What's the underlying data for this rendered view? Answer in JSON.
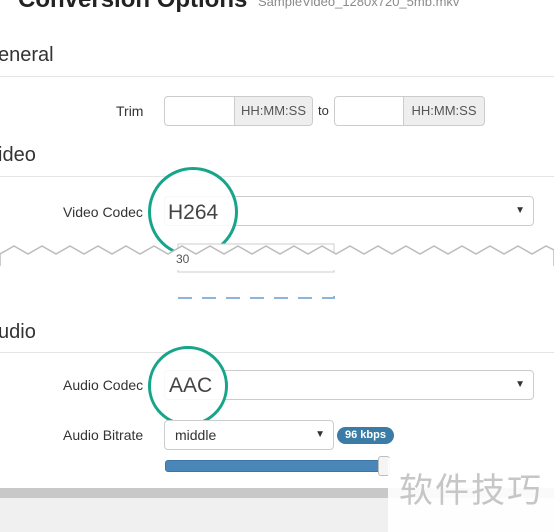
{
  "page": {
    "title": "Conversion Options",
    "subtitle": "SampleVideo_1280x720_5mb.mkv"
  },
  "general": {
    "heading": "eneral",
    "trim_label": "Trim",
    "trim_start_value": "",
    "trim_start_unit": "HH:MM:SS",
    "trim_to": "to",
    "trim_end_value": "",
    "trim_end_unit": "HH:MM:SS"
  },
  "video": {
    "heading": "ideo",
    "codec_label": "Video Codec",
    "codec_value": "H264",
    "frame_rate_partial": "30"
  },
  "audio": {
    "heading": "udio",
    "codec_label": "Audio Codec",
    "codec_value": "AAC",
    "bitrate_label": "Audio Bitrate",
    "bitrate_value": "middle",
    "bitrate_badge": "96 kbps",
    "bitrate_level": 0.96
  },
  "watermark": "软件技巧",
  "colors": {
    "highlight_ring": "#17a589",
    "badge": "#3a7ca5",
    "slider": "#4a86b8"
  },
  "icons": [
    "dropdown-caret-icon"
  ]
}
